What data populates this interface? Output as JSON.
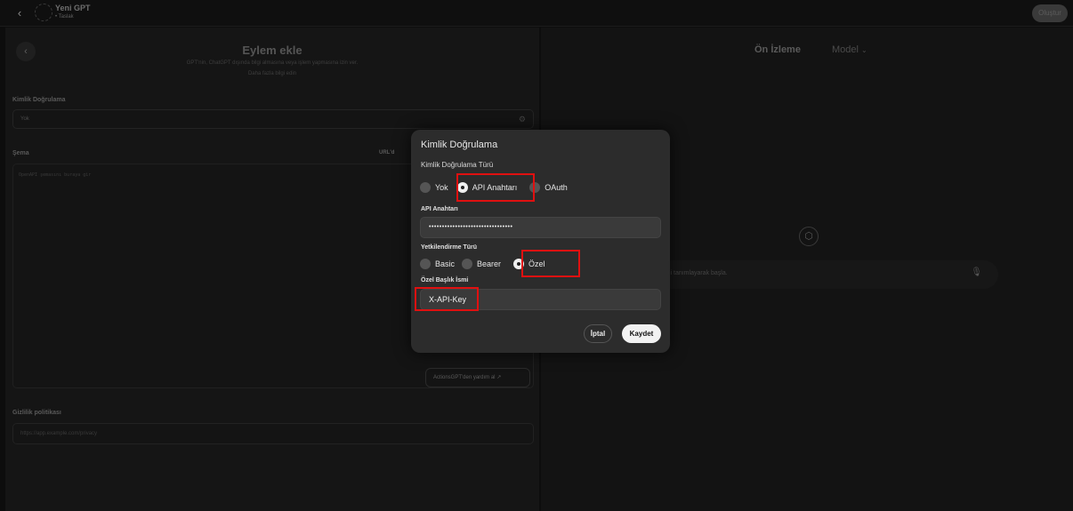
{
  "topbar": {
    "back_icon": "chevron-left-icon",
    "gpt_name": "Yeni GPT",
    "gpt_status": "• Taslak",
    "create_label": "Oluştur"
  },
  "left_panel": {
    "title": "Eylem ekle",
    "subtitle": "GPT'nin, ChatGPT dışında bilgi almasına veya işlem yapmasına izin ver.",
    "learn_more": "Daha fazla bilgi edin",
    "auth_label": "Kimlik Doğrulama",
    "auth_value": "Yok",
    "schema_label": "Şema",
    "url_import": "URL'd",
    "schema_placeholder": "OpenAPI şemasını buraya gir",
    "actionsgpt_label": "ActionsGPT'den yardım al",
    "privacy_label": "Gizlilik politikası",
    "privacy_placeholder": "https://app.example.com/privacy"
  },
  "right_panel": {
    "preview_label": "Ön İzleme",
    "model_label": "Model",
    "chat_placeholder": "T'ni tanımlayarak başla."
  },
  "modal": {
    "title": "Kimlik Doğrulama",
    "auth_type_label": "Kimlik Doğrulama Türü",
    "auth_types": [
      "Yok",
      "API Anahtarı",
      "OAuth"
    ],
    "auth_type_selected": "API Anahtarı",
    "api_key_label": "API Anahtarı",
    "api_key_value": "••••••••••••••••••••••••••••••••",
    "authz_type_label": "Yetkilendirme Türü",
    "authz_types": [
      "Basic",
      "Bearer",
      "Özel"
    ],
    "authz_type_selected": "Özel",
    "custom_header_label": "Özel Başlık İsmi",
    "custom_header_value": "X-API-Key",
    "cancel_label": "İptal",
    "save_label": "Kaydet"
  },
  "colors": {
    "highlight": "#e01010",
    "modal_bg": "#2c2c2c",
    "page_bg": "#0d0d0d"
  }
}
